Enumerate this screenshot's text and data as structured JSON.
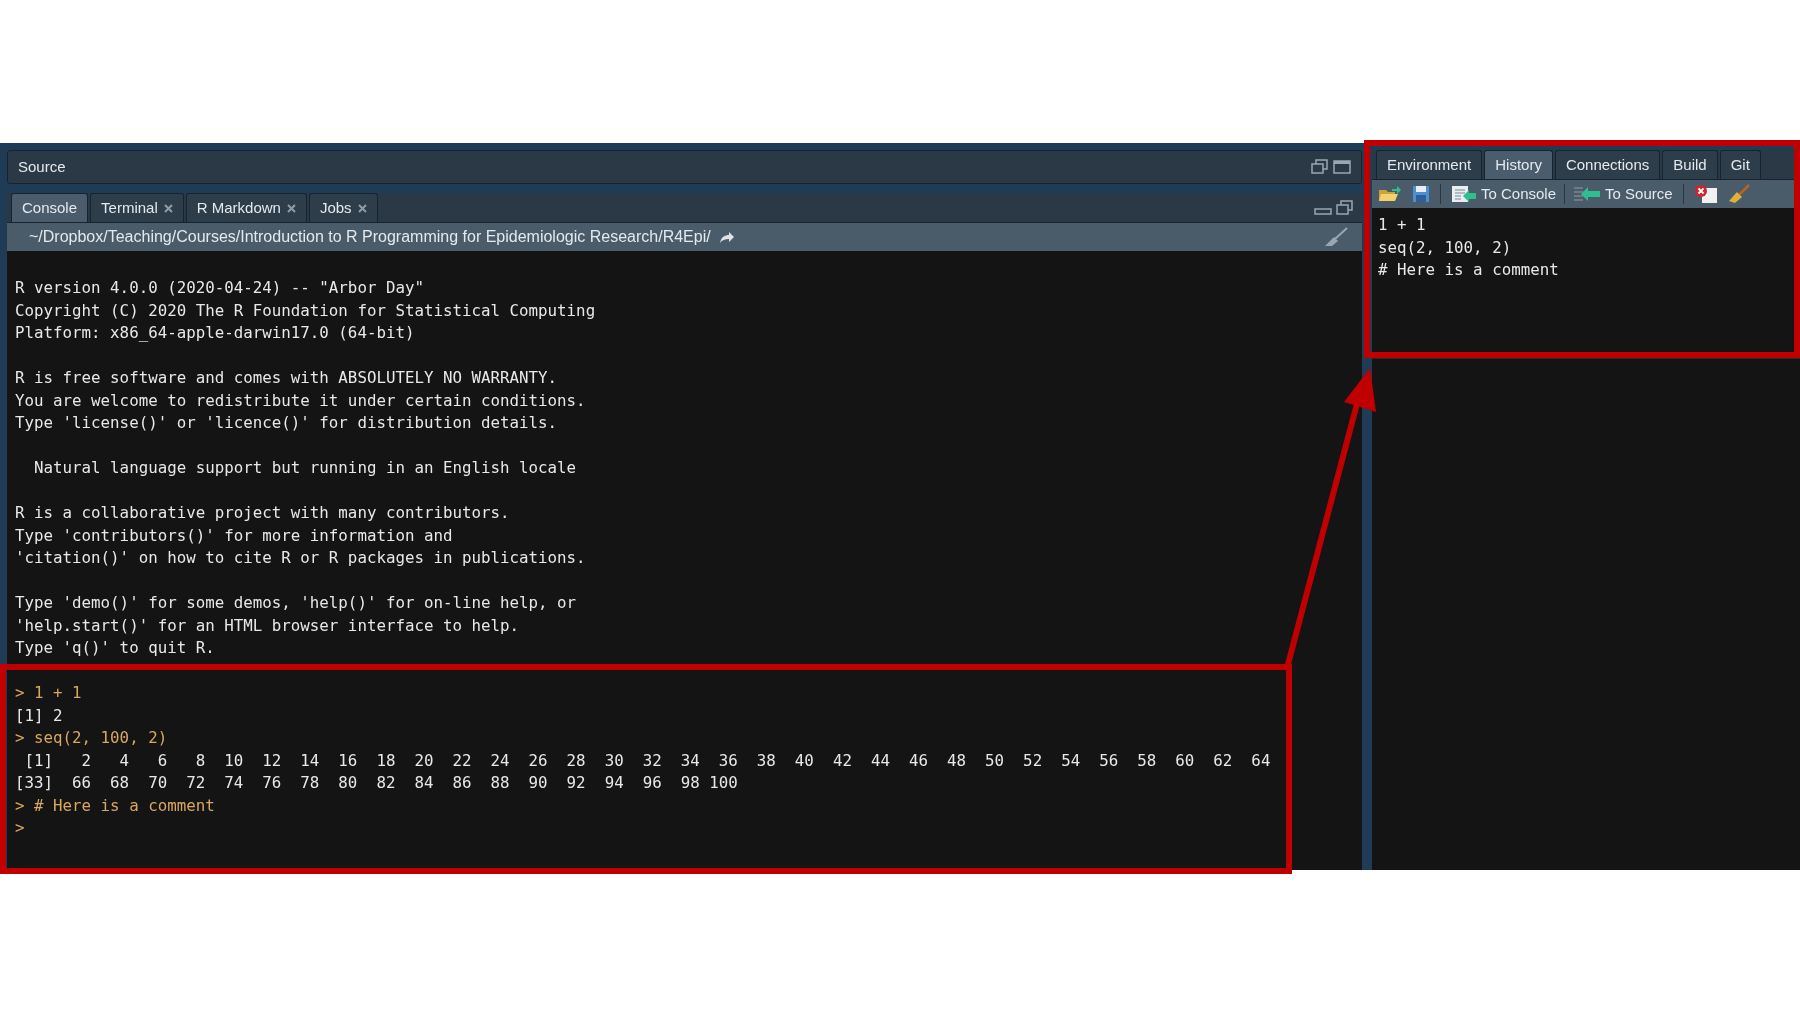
{
  "source_pane": {
    "title": "Source"
  },
  "console_pane": {
    "tabs": [
      {
        "label": "Console",
        "selected": true,
        "closable": false
      },
      {
        "label": "Terminal",
        "selected": false,
        "closable": true
      },
      {
        "label": "R Markdown",
        "selected": false,
        "closable": true
      },
      {
        "label": "Jobs",
        "selected": false,
        "closable": true
      }
    ],
    "working_directory": "~/Dropbox/Teaching/Courses/Introduction to R Programming for Epidemiologic Research/R4Epi/",
    "startup_message": [
      [
        "R version 4.0.0 (2020-04-24) -- \"Arbor Day\"",
        "Copyright (C) 2020 The R Foundation for Statistical Computing",
        "Platform: x86_64-apple-darwin17.0 (64-bit)"
      ],
      [
        "R is free software and comes with ABSOLUTELY NO WARRANTY.",
        "You are welcome to redistribute it under certain conditions.",
        "Type 'license()' or 'licence()' for distribution details."
      ],
      [
        "  Natural language support but running in an English locale"
      ],
      [
        "R is a collaborative project with many contributors.",
        "Type 'contributors()' for more information and",
        "'citation()' on how to cite R or R packages in publications."
      ],
      [
        "Type 'demo()' for some demos, 'help()' for on-line help, or",
        "'help.start()' for an HTML browser interface to help.",
        "Type 'q()' to quit R."
      ]
    ],
    "session": [
      {
        "kind": "input",
        "text": "> 1 + 1"
      },
      {
        "kind": "output",
        "text": "[1] 2"
      },
      {
        "kind": "input",
        "text": "> seq(2, 100, 2)"
      },
      {
        "kind": "output",
        "text": " [1]   2   4   6   8  10  12  14  16  18  20  22  24  26  28  30  32  34  36  38  40  42  44  46  48  50  52  54  56  58  60  62  64"
      },
      {
        "kind": "output",
        "text": "[33]  66  68  70  72  74  76  78  80  82  84  86  88  90  92  94  96  98 100"
      },
      {
        "kind": "input",
        "text": "> # Here is a comment"
      },
      {
        "kind": "input",
        "text": ">"
      }
    ]
  },
  "history_pane": {
    "tabs": [
      {
        "label": "Environment",
        "selected": false
      },
      {
        "label": "History",
        "selected": true
      },
      {
        "label": "Connections",
        "selected": false
      },
      {
        "label": "Build",
        "selected": false
      },
      {
        "label": "Git",
        "selected": false
      }
    ],
    "actions": [
      {
        "kind": "to-console",
        "label": "To Console"
      },
      {
        "kind": "to-source",
        "label": "To Source"
      }
    ],
    "entries": [
      "1 + 1",
      "seq(2, 100, 2)",
      "# Here is a comment"
    ]
  }
}
